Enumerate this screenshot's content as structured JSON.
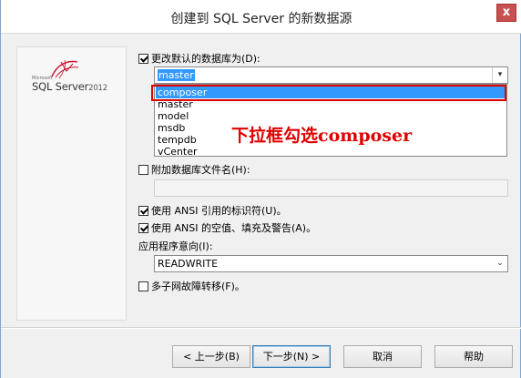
{
  "window": {
    "title": "创建到 SQL Server 的新数据源",
    "close_glyph": "x"
  },
  "logo": {
    "small": "Microsoft",
    "main": "SQL Server",
    "year": "2012"
  },
  "change_default_db": {
    "checked": true,
    "label": "更改默认的数据库为(D):",
    "value": "master"
  },
  "db_options": [
    "composer",
    "master",
    "model",
    "msdb",
    "tempdb",
    "vCenter"
  ],
  "selected_option": "composer",
  "annotation": "下拉框勾选composer",
  "attach_db": {
    "checked": false,
    "label": "附加数据库文件名(H):",
    "value": ""
  },
  "ansi_quoted": {
    "checked": true,
    "label": "使用 ANSI 引用的标识符(U)。"
  },
  "ansi_nulls": {
    "checked": true,
    "label": "使用 ANSI 的空值、填充及警告(A)。"
  },
  "app_intent": {
    "label": "应用程序意向(I):",
    "value": "READWRITE"
  },
  "multi_subnet": {
    "checked": false,
    "label": "多子网故障转移(F)。"
  },
  "buttons": {
    "back": "< 上一步(B)",
    "next": "下一步(N) >",
    "cancel": "取消",
    "help": "帮助"
  }
}
